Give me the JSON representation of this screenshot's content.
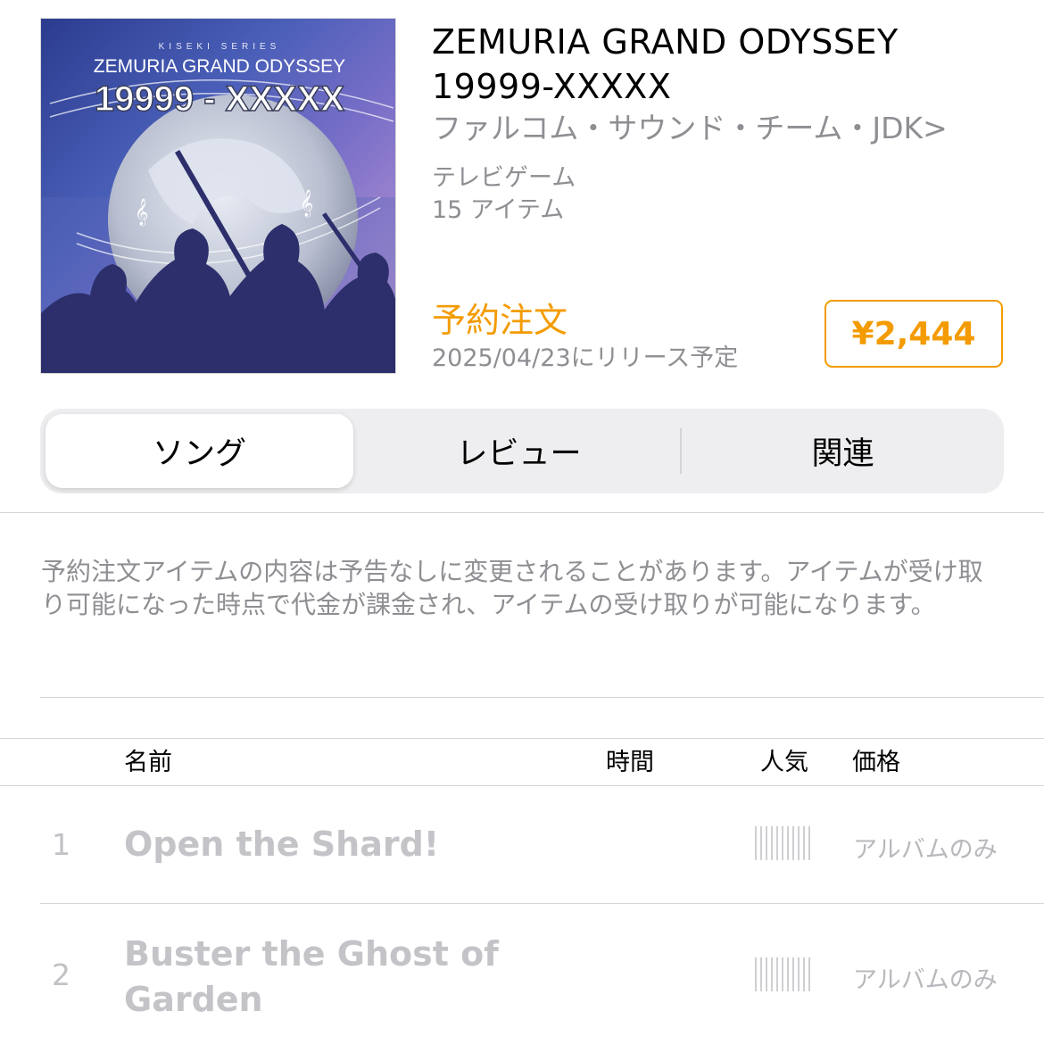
{
  "album": {
    "art_series": "KISEKI SERIES",
    "art_title": "ZEMURIA GRAND ODYSSEY",
    "art_number": "19999 - XXXXX",
    "title_line1": "ZEMURIA GRAND ODYSSEY",
    "title_line2": "19999-XXXXX",
    "artist": "ファルコム・サウンド・チーム・JDK",
    "artist_chevron": ">",
    "genre": "テレビゲーム",
    "item_count": "15 アイテム",
    "preorder_label": "予約注文",
    "release_note": "2025/04/23にリリース予定",
    "price": "¥2,444"
  },
  "tabs": [
    {
      "label": "ソング",
      "active": true
    },
    {
      "label": "レビュー",
      "active": false
    },
    {
      "label": "関連",
      "active": false
    }
  ],
  "notice": "予約注文アイテムの内容は予告なしに変更されることがあります。アイテムが受け取り可能になった時点で代金が課金され、アイテムの受け取りが可能になります。",
  "table": {
    "headers": {
      "name": "名前",
      "time": "時間",
      "popularity": "人気",
      "price": "価格"
    },
    "rows": [
      {
        "num": "1",
        "title": "Open the Shard!",
        "price": "アルバムのみ",
        "popularity": 0
      },
      {
        "num": "2",
        "title": "Buster the Ghost of Garden",
        "price": "アルバムのみ",
        "popularity": 0
      }
    ]
  },
  "colors": {
    "accent": "#f39b00",
    "secondary_text": "#8e8e93",
    "disabled_text": "#c4c4c8"
  }
}
